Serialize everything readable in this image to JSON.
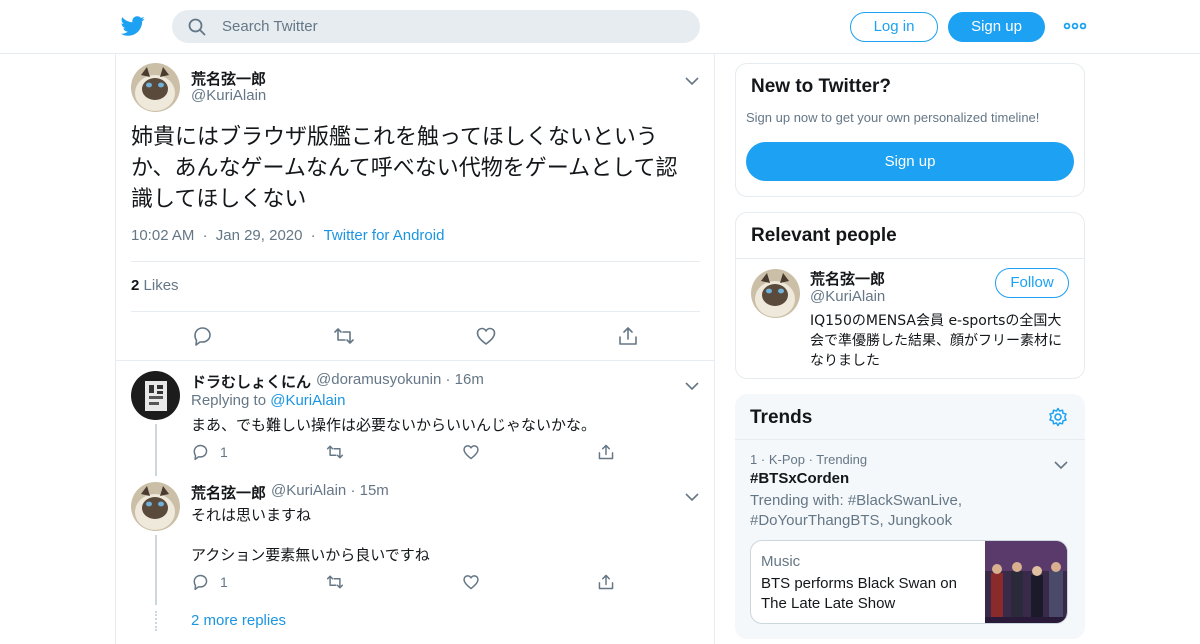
{
  "header": {
    "search_placeholder": "Search Twitter",
    "login_label": "Log in",
    "signup_label": "Sign up",
    "more_icon": "more-dots-icon",
    "logo_icon": "twitter-bird-icon"
  },
  "main_tweet": {
    "author_name": "荒名弦一郎",
    "author_handle": "@KuriAlain",
    "text": "姉貴にはブラウザ版艦これを触ってほしくないというか、あんなゲームなんて呼べない代物をゲームとして認識してほしくない",
    "time": "10:02 AM",
    "date": "Jan 29, 2020",
    "source": "Twitter for Android",
    "likes_count": "2",
    "likes_label": "Likes"
  },
  "replies": [
    {
      "author_name": "ドラむしょくにん",
      "author_handle": "@doramusyokunin",
      "age": "16m",
      "replying_prefix": "Replying to",
      "replying_to": "@KuriAlain",
      "text": "まあ、でも難しい操作は必要ないからいいんじゃないかな。",
      "reply_count": "1"
    },
    {
      "author_name": "荒名弦一郎",
      "author_handle": "@KuriAlain",
      "age": "15m",
      "text_line1": "それは思いますね",
      "text_line2": "アクション要素無いから良いですね",
      "reply_count": "1"
    }
  ],
  "more_replies": "2 more replies",
  "sidebar": {
    "new_title": "New to Twitter?",
    "new_sub": "Sign up now to get your own personalized timeline!",
    "new_signup": "Sign up",
    "relevant_title": "Relevant people",
    "person_name": "荒名弦一郎",
    "person_handle": "@KuriAlain",
    "follow_label": "Follow",
    "person_bio": "IQ150のMENSA会員 e-sportsの全国大会で準優勝した結果、顔がフリー素材になりました",
    "trends_title": "Trends",
    "trend_rank": "1",
    "trend_category": "K-Pop",
    "trend_status": "Trending",
    "trend_name": "#BTSxCorden",
    "trend_with": "Trending with: #BlackSwanLive, #DoYourThangBTS, Jungkook",
    "news_category": "Music",
    "news_title": "BTS performs Black Swan on The Late Late Show"
  },
  "colors": {
    "accent": "#1da1f2",
    "link": "#1b95e0",
    "muted": "#657786",
    "border": "#e6ecf0"
  }
}
